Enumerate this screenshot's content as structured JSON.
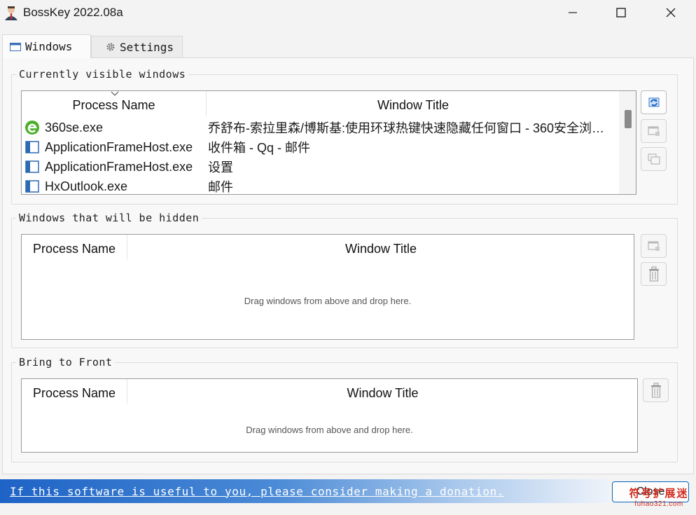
{
  "window": {
    "title": "BossKey 2022.08a",
    "controls": {
      "minimize": "minimize",
      "maximize": "maximize",
      "close": "close"
    }
  },
  "tabs": [
    {
      "label": "Windows",
      "icon": "window-icon",
      "active": true
    },
    {
      "label": "Settings",
      "icon": "gear-icon",
      "active": false
    }
  ],
  "visible_group": {
    "title": "Currently visible windows",
    "columns": [
      "Process Name",
      "Window Title"
    ],
    "rows": [
      {
        "process": "360se.exe",
        "title": "乔舒布-索拉里森/博斯基:使用环球热键快速隐藏任何窗口 - 360安全浏…",
        "icon": "browser-360-icon"
      },
      {
        "process": "ApplicationFrameHost.exe",
        "title": "收件箱 - Qq - 邮件",
        "icon": "app-window-icon"
      },
      {
        "process": "ApplicationFrameHost.exe",
        "title": "设置",
        "icon": "app-window-icon"
      },
      {
        "process": "HxOutlook.exe",
        "title": "邮件",
        "icon": "app-window-icon"
      }
    ]
  },
  "hidden_group": {
    "title": "Windows that will be hidden",
    "columns": [
      "Process Name",
      "Window Title"
    ],
    "hint": "Drag windows from above and drop here."
  },
  "front_group": {
    "title": "Bring to Front",
    "columns": [
      "Process Name",
      "Window Title"
    ],
    "hint": "Drag windows from above and drop here."
  },
  "footer": {
    "donate_text": "If this software is useful to you, please consider making a donation.",
    "close_label": "Close"
  },
  "watermark": {
    "top": "符号扩展迷",
    "bottom": "fuhao321.com"
  },
  "colors": {
    "accent": "#0067c0",
    "donate_bar": "#1e63c6",
    "watermark": "#d42a1c"
  }
}
